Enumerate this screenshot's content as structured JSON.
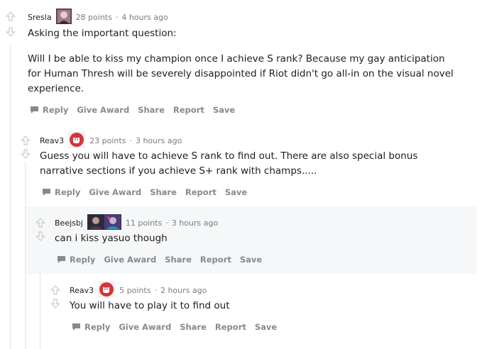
{
  "comments": [
    {
      "author": "Sresla",
      "flair_icon": "champion-portrait-icon",
      "points": "28 points",
      "time": "4 hours ago",
      "paragraphs": [
        "Asking the important question:",
        "Will I be able to kiss my champion once I achieve S rank? Because my gay anticipation for Human Thresh will be severely disappointed if Riot didn't go all-in on the visual novel experience."
      ]
    },
    {
      "author": "Reav3",
      "flair_icon": "riot-fist-icon",
      "points": "23 points",
      "time": "3 hours ago",
      "paragraphs": [
        "Guess you will have to achieve S rank to find out. There are also special bonus narrative sections if you achieve S+ rank with champs....."
      ]
    },
    {
      "author": "Beejsbj",
      "flair_icon": "champion-portraits-icon",
      "points": "11 points",
      "time": "3 hours ago",
      "paragraphs": [
        "can i kiss yasuo though"
      ]
    },
    {
      "author": "Reav3",
      "flair_icon": "riot-fist-icon",
      "points": "5 points",
      "time": "2 hours ago",
      "paragraphs": [
        "You will have to play it to find out"
      ]
    }
  ],
  "actions": {
    "reply": "Reply",
    "give_award": "Give Award",
    "share": "Share",
    "report": "Report",
    "save": "Save"
  },
  "colors": {
    "riot_red": "#d13639",
    "highlight_bg": "#f6f7f8",
    "action_gray": "#878a8c"
  }
}
